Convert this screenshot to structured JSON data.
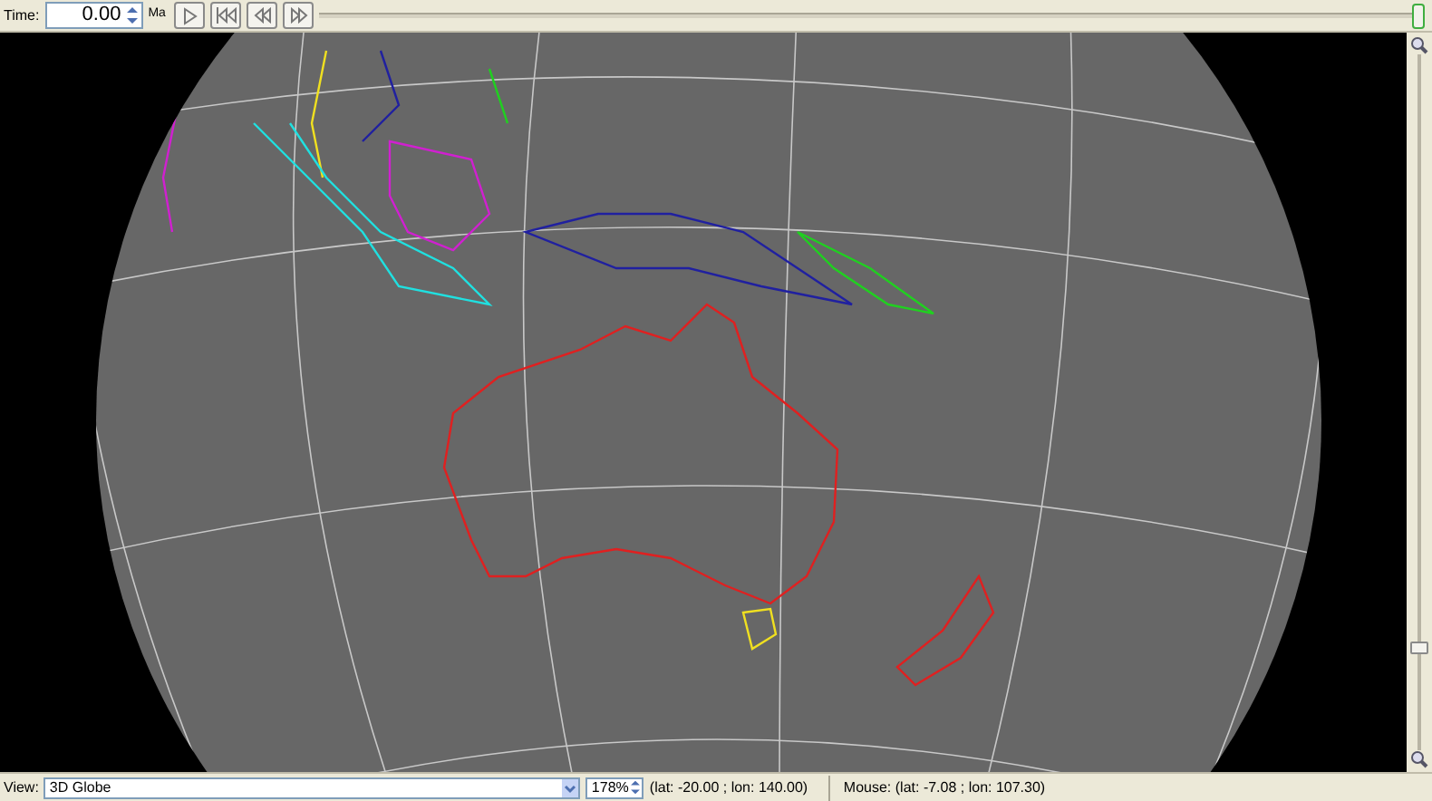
{
  "toolbar": {
    "time_label": "Time:",
    "time_value": "0.00",
    "time_unit": "Ma",
    "time_slider": {
      "level": 1
    }
  },
  "globe_view": {
    "zoom_slider": {
      "level": 0.14
    }
  },
  "status_bar": {
    "view_label": "View:",
    "view_value": "3D Globe",
    "zoom": "178%",
    "camera": "(lat: -20.00 ; lon: 140.00)",
    "mouse": "Mouse: (lat: -7.08 ; lon: 107.30)"
  }
}
